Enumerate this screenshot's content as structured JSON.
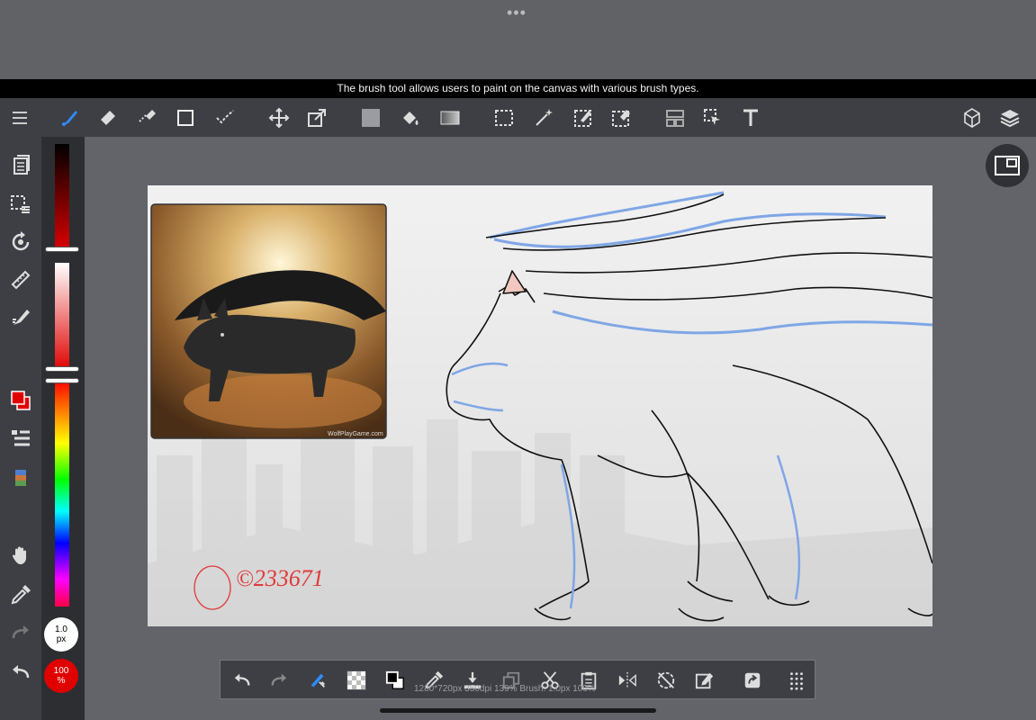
{
  "top": {
    "dots": "•••"
  },
  "tooltip": "The brush tool allows users to paint on the canvas with various brush types.",
  "main_toolbar": {
    "left": [
      "menu-icon",
      "brush-icon",
      "eraser-icon",
      "lasso-eraser-icon",
      "rectangle-icon",
      "check-brush-icon",
      "move-icon",
      "transform-icon",
      "fill-rect-icon",
      "bucket-icon",
      "gradient-icon",
      "select-rect-icon",
      "magic-wand-icon",
      "select-pen-icon",
      "select-eraser-icon",
      "frame-icon",
      "select-arrow-icon",
      "text-icon"
    ],
    "right": [
      "3d-icon",
      "layers-icon"
    ],
    "active": "brush-icon",
    "accent": "#2f8cff"
  },
  "left_toolbar": [
    "pages-icon",
    "selection-list-icon",
    "rotate-icon",
    "ruler-icon",
    "filter-brush-icon",
    "color-swatch-icon",
    "layer-list-icon",
    "color-palette-icon",
    "hand-icon",
    "eyedropper-icon",
    "redo-icon",
    "undo-icon"
  ],
  "color_sliders": {
    "primary_color": "#e00000",
    "size_label": "1.0",
    "size_unit": "px",
    "opacity_label": "100",
    "opacity_unit": "%"
  },
  "canvas": {
    "watermark": "WolfPlayGame.com",
    "signature": "©233671"
  },
  "bottom_toolbar": {
    "items": [
      "undo-icon",
      "redo-icon",
      "brush-settings-icon",
      "transparency-icon",
      "color-swap-icon",
      "eyedropper-icon",
      "import-icon",
      "copy-icon",
      "cut-icon",
      "paste-icon",
      "flip-icon",
      "rotate-off-icon",
      "edit-icon",
      "share-icon",
      "grid-dots-icon"
    ],
    "status": "1280*720px 350dpi 139% Brush: 1.0px 100%"
  }
}
